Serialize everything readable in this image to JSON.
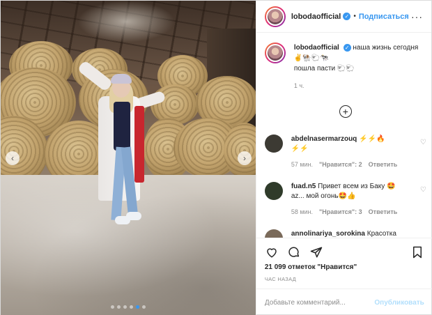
{
  "post": {
    "username": "lobodaofficial",
    "separator": "•",
    "follow_label": "Подписаться",
    "more_label": "···",
    "caption_line1": "наша жизнь сегодня",
    "caption_emoji1": "✌🐏🐑🐄",
    "caption_line2": "пошла пасти",
    "caption_emoji2": "🐑🐑",
    "caption_time": "1 ч.",
    "load_more": "+"
  },
  "comments": [
    {
      "username": "abdelnasermarzouq",
      "text_inline": "⚡⚡🔥",
      "text_line2": "⚡⚡",
      "time": "57 мин.",
      "likes": "\"Нравится\": 2",
      "reply": "Ответить",
      "avatar_color": "#3c3a33"
    },
    {
      "username": "fuad.n5",
      "text_inline": "Привет всем из Баку 🤩",
      "text_line2": "az... мой огонь🤩👍",
      "time": "58 мин.",
      "likes": "\"Нравится\": 3",
      "reply": "Ответить",
      "avatar_color": "#2f3b2a"
    },
    {
      "username": "annolinariya_sorokina",
      "text_inline": "Красотка",
      "avatar_color": "#7a6a5a"
    }
  ],
  "footer": {
    "likes_text": "21 099 отметок \"Нравится\"",
    "posted_ago": "ЧАС НАЗАД",
    "comment_placeholder": "Добавьте комментарий...",
    "publish_label": "Опубликовать"
  },
  "icons": {
    "heart": "heart-icon",
    "comment": "comment-icon",
    "share": "share-icon",
    "save": "bookmark-icon",
    "verified": "verified-badge-icon",
    "prev": "chevron-left-icon",
    "next": "chevron-right-icon"
  },
  "carousel": {
    "slides": 6,
    "active_index": 4
  },
  "colors": {
    "accent": "#3897f0",
    "text": "#262626",
    "muted": "#8e8e8e",
    "publish_disabled": "#b2dffc"
  }
}
